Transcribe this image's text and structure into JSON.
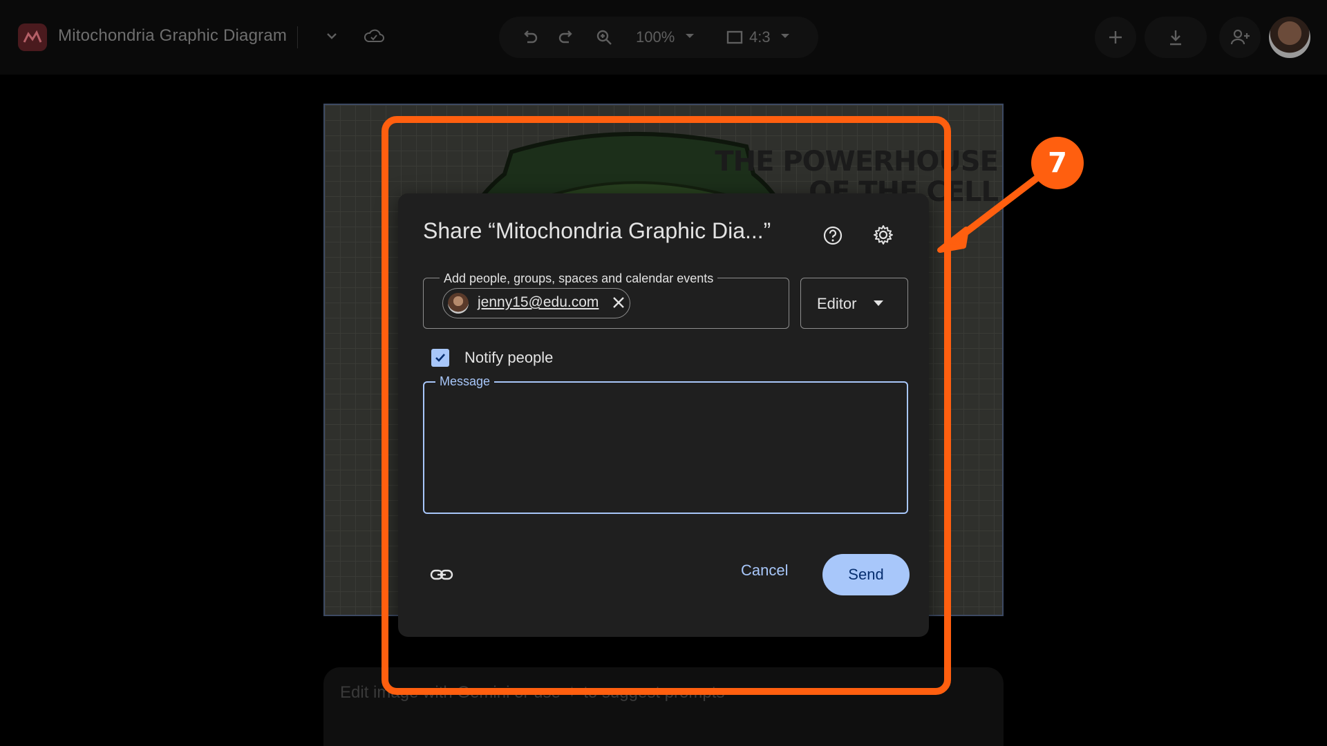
{
  "header": {
    "doc_title": "Mitochondria Graphic Diagram",
    "zoom": "100%",
    "aspect_ratio": "4:3"
  },
  "slide": {
    "title_line1": "THE POWERHOUSE",
    "title_line2": "OF THE CELL"
  },
  "bottom_prompt": {
    "placeholder": "Edit image with Gemini or use ✦ to suggest prompts"
  },
  "share_dialog": {
    "title": "Share “Mitochondria Graphic Dia...”",
    "add_label": "Add people, groups, spaces and calendar events",
    "recipient_chip": "jenny15@edu.com",
    "role": "Editor",
    "notify_label": "Notify people",
    "notify_checked": true,
    "message_label": "Message",
    "message_value": "",
    "cancel_label": "Cancel",
    "send_label": "Send"
  },
  "annotation": {
    "step_number": "7",
    "color": "#ff5f0f"
  },
  "colors": {
    "accent": "#a8c7fa",
    "dialog_bg": "#1f1f1f"
  }
}
